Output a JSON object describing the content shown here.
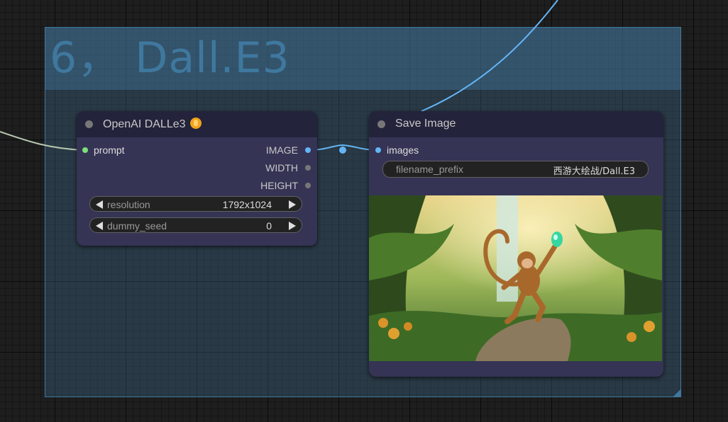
{
  "group": {
    "title": "6， Dall.E3"
  },
  "nodes": {
    "dalle": {
      "title": "OpenAI DALLe3",
      "inputs": [
        {
          "label": "prompt"
        }
      ],
      "outputs": [
        {
          "label": "IMAGE"
        },
        {
          "label": "WIDTH"
        },
        {
          "label": "HEIGHT"
        }
      ],
      "widgets": {
        "resolution": {
          "label": "resolution",
          "value": "1792x1024"
        },
        "dummy_seed": {
          "label": "dummy_seed",
          "value": "0"
        }
      }
    },
    "save": {
      "title": "Save Image",
      "inputs": [
        {
          "label": "images"
        }
      ],
      "widgets": {
        "filename_prefix": {
          "label": "filename_prefix",
          "value": "西游大绘战/Dall.E3"
        }
      }
    }
  },
  "colors": {
    "group_fill": "#4479a1",
    "link_image": "#64b5f6",
    "link_prompt": "#b8c8b0",
    "slot_string": "#7ee07a",
    "slot_image": "#64b5f6",
    "slot_int": "#777777"
  }
}
